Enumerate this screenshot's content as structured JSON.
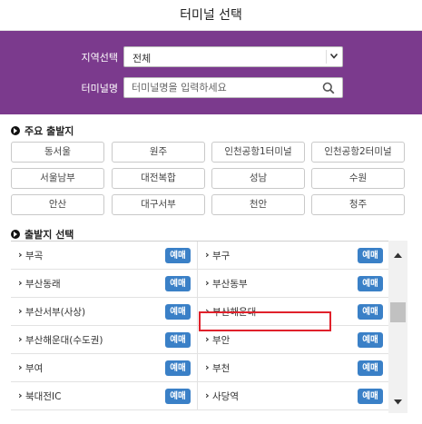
{
  "header": {
    "title": "터미널 선택"
  },
  "search": {
    "region_label": "지역선택",
    "region_value": "전체",
    "terminal_label": "터미널명",
    "terminal_placeholder": "터미널명을 입력하세요"
  },
  "major": {
    "title": "주요 출발지",
    "items": [
      "동서울",
      "원주",
      "인천공항1터미널",
      "인천공항2터미널",
      "서울남부",
      "대전복합",
      "성남",
      "수원",
      "안산",
      "대구서부",
      "천안",
      "청주"
    ]
  },
  "departure": {
    "title": "출발지 선택",
    "reserve_label": "예매",
    "rows": [
      {
        "left": "부곡",
        "right": "부구"
      },
      {
        "left": "부산동래",
        "right": "부산동부"
      },
      {
        "left": "부산서부(사상)",
        "right": "부산해운대"
      },
      {
        "left": "부산해운대(수도권)",
        "right": "부안"
      },
      {
        "left": "부여",
        "right": "부천"
      },
      {
        "left": "북대전IC",
        "right": "사당역"
      }
    ],
    "selected": "부산해운대"
  },
  "icons": {
    "dropdown": "chevron-down-icon",
    "search": "search-icon",
    "section": "arrow-circle-icon",
    "row": "chevron-right-icon"
  },
  "colors": {
    "panel": "#7b3a8d",
    "reserve": "#3a80c7",
    "highlight": "#e0212b"
  }
}
